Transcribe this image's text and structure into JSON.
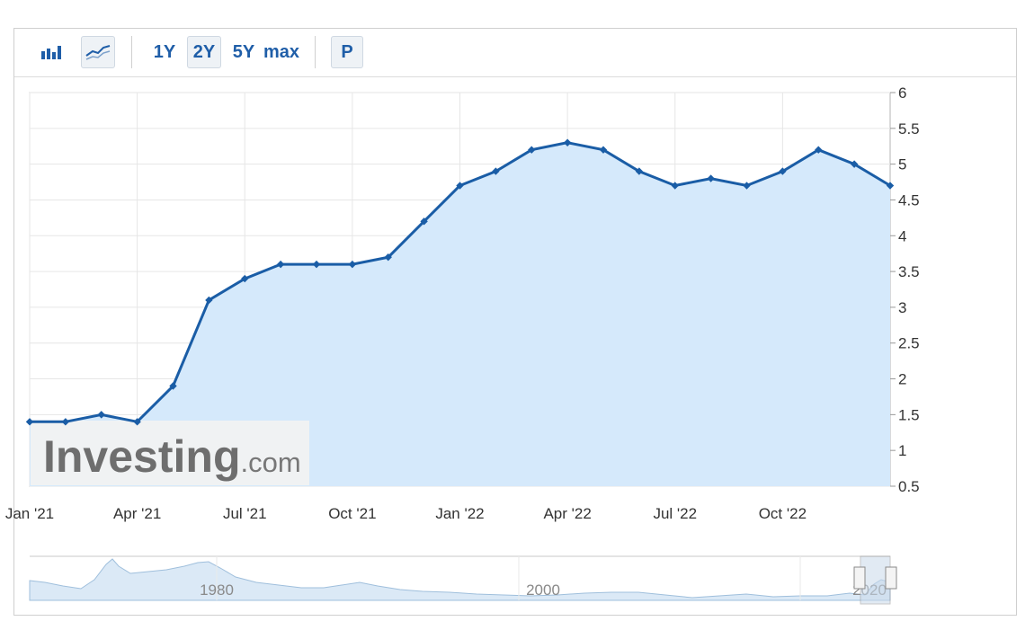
{
  "toolbar": {
    "bar_icon": "bar-chart-icon",
    "line_icon": "line-chart-icon",
    "ranges": [
      "1Y",
      "2Y",
      "5Y",
      "max"
    ],
    "active_range": "2Y",
    "p_label": "P"
  },
  "watermark": {
    "brand": "Investing",
    "suffix": ".com"
  },
  "navigator": {
    "labels": [
      "1980",
      "2000",
      "2020"
    ]
  },
  "colors": {
    "line": "#1a5da6",
    "area": "#d5e9fb",
    "grid": "#e6e6e6",
    "navigator_area": "#dbe9f6"
  },
  "chart_data": {
    "type": "area",
    "x": [
      "Jan '21",
      "Feb '21",
      "Mar '21",
      "Apr '21",
      "May '21",
      "Jun '21",
      "Jul '21",
      "Aug '21",
      "Sep '21",
      "Oct '21",
      "Nov '21",
      "Dec '21",
      "Jan '22",
      "Feb '22",
      "Mar '22",
      "Apr '22",
      "May '22",
      "Jun '22",
      "Jul '22",
      "Aug '22",
      "Sep '22",
      "Oct '22",
      "Nov '22",
      "Dec '22",
      "Jan '23"
    ],
    "values": [
      1.4,
      1.4,
      1.5,
      1.4,
      1.9,
      3.1,
      3.4,
      3.6,
      3.6,
      3.6,
      3.7,
      4.2,
      4.7,
      4.9,
      5.2,
      5.3,
      5.2,
      4.9,
      4.7,
      4.8,
      4.7,
      4.9,
      5.2,
      5.0,
      4.7
    ],
    "x_tick_labels": [
      "Jan '21",
      "Apr '21",
      "Jul '21",
      "Oct '21",
      "Jan '22",
      "Apr '22",
      "Jul '22",
      "Oct '22"
    ],
    "y_ticks": [
      "6",
      "5.5",
      "5",
      "4.5",
      "4",
      "3.5",
      "3",
      "2.5",
      "2",
      "1.5",
      "1",
      "0.5"
    ],
    "ylim": [
      0.5,
      6
    ],
    "grid": true,
    "y_axis_side": "right",
    "title": "",
    "xlabel": "",
    "ylabel": ""
  }
}
